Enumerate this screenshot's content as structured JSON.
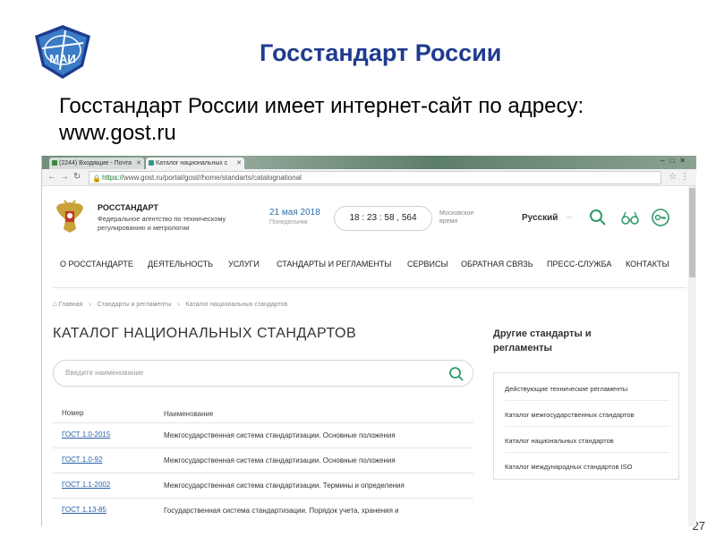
{
  "slide": {
    "logo_text": "МАИ",
    "title": "Госстандарт России",
    "body": "Госстандарт России имеет интернет-сайт по адресу: www.gost.ru",
    "page_number": "27"
  },
  "browser": {
    "tabs": [
      {
        "label": "(2244) Входящие - Почта"
      },
      {
        "label": "Каталог национальных с"
      }
    ],
    "url_scheme": "https://",
    "url_rest": "www.gost.ru/portal/gost//home/standarts/catalognational"
  },
  "site": {
    "org_name": "РОССТАНДАРТ",
    "org_sub": "Федеральное агентство по техническому регулированию и метрологии",
    "date": "21 мая 2018",
    "weekday": "Понедельник",
    "clock": "18 : 23 : 58 , 564",
    "timezone": "Московское время",
    "language": "Русский",
    "nav": [
      "О РОССТАНДАРТЕ",
      "ДЕЯТЕЛЬНОСТЬ",
      "УСЛУГИ",
      "СТАНДАРТЫ И РЕГЛАМЕНТЫ",
      "СЕРВИСЫ",
      "ОБРАТНАЯ СВЯЗЬ",
      "ПРЕСС-СЛУЖБА",
      "КОНТАКТЫ"
    ],
    "breadcrumbs": [
      "Главная",
      "Стандарты и регламенты",
      "Каталог национальных стандартов"
    ],
    "catalog_title": "КАТАЛОГ НАЦИОНАЛЬНЫХ СТАНДАРТОВ",
    "search_placeholder": "Введите наименование",
    "table": {
      "headers": [
        "Номер",
        "Наименование"
      ],
      "rows": [
        [
          "ГОСТ 1.0-2015",
          "Межгосударственная система стандартизации. Основные положения"
        ],
        [
          "ГОСТ 1.0-92",
          "Межгосударственная система стандартизации. Основные положения"
        ],
        [
          "ГОСТ 1.1-2002",
          "Межгосударственная система стандартизации. Термины и определения"
        ],
        [
          "ГОСТ 1.13-85",
          "Государственная система стандартизации. Порядок учета, хранения и"
        ]
      ]
    },
    "sidebar_title": "Другие стандарты и регламенты",
    "sidebar_links": [
      "Действующие технические регламенты",
      "Каталог межгосударственных стандартов",
      "Каталог национальных стандартов",
      "Каталог международных стандартов ISO"
    ]
  },
  "colors": {
    "slide_title": "#1f3b8f",
    "link": "#2a5fa8",
    "accent_green": "#2e9a6a"
  }
}
